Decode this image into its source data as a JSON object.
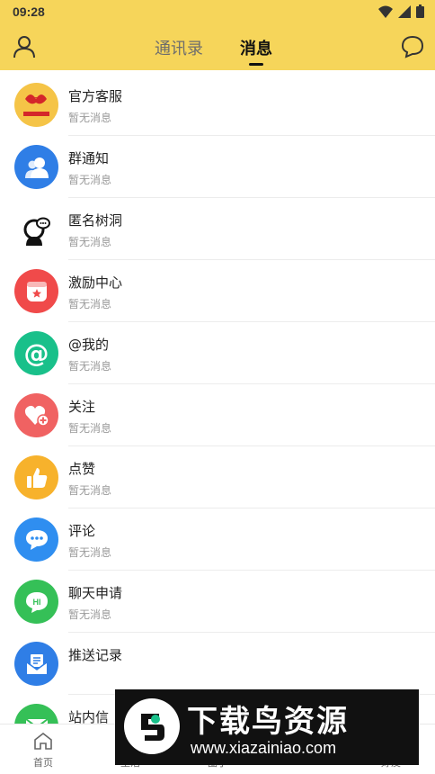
{
  "status_bar": {
    "time": "09:28"
  },
  "header": {
    "tabs": [
      {
        "label": "通讯录",
        "active": false
      },
      {
        "label": "消息",
        "active": true
      }
    ],
    "left_icon": "profile-icon",
    "right_icon": "chat-bubble-icon",
    "background": "#f6d55a"
  },
  "list": [
    {
      "title": "官方客服",
      "subtitle": "暂无消息",
      "icon": "official-service-logo"
    },
    {
      "title": "群通知",
      "subtitle": "暂无消息",
      "icon": "group-icon",
      "color": "#2f7ee6"
    },
    {
      "title": "匿名树洞",
      "subtitle": "暂无消息",
      "icon": "anonymous-icon"
    },
    {
      "title": "激励中心",
      "subtitle": "暂无消息",
      "icon": "reward-icon",
      "color": "#f04a4a"
    },
    {
      "title": "@我的",
      "subtitle": "暂无消息",
      "icon": "at-icon",
      "color": "#19c08a"
    },
    {
      "title": "关注",
      "subtitle": "暂无消息",
      "icon": "heart-plus-icon",
      "color": "#f06262"
    },
    {
      "title": "点赞",
      "subtitle": "暂无消息",
      "icon": "thumbs-up-icon",
      "color": "#f7b22c"
    },
    {
      "title": "评论",
      "subtitle": "暂无消息",
      "icon": "comment-icon",
      "color": "#2f8ef0"
    },
    {
      "title": "聊天申请",
      "subtitle": "暂无消息",
      "icon": "hi-chat-icon",
      "color": "#35c057"
    },
    {
      "title": "推送记录",
      "subtitle": "",
      "icon": "push-mail-icon",
      "color": "#2f7ee6"
    },
    {
      "title": "站内信",
      "subtitle": "",
      "icon": "mail-icon",
      "color": "#35c057"
    }
  ],
  "bottom_nav": [
    {
      "label": "首页",
      "icon": "home-icon"
    },
    {
      "label": "生活",
      "icon": "life-icon"
    },
    {
      "label": "圈子",
      "icon": "circle-icon"
    },
    {
      "label": "好友",
      "icon": "friends-icon"
    }
  ],
  "watermark": {
    "title": "下载鸟资源",
    "url": "www.xiazainiao.com"
  }
}
